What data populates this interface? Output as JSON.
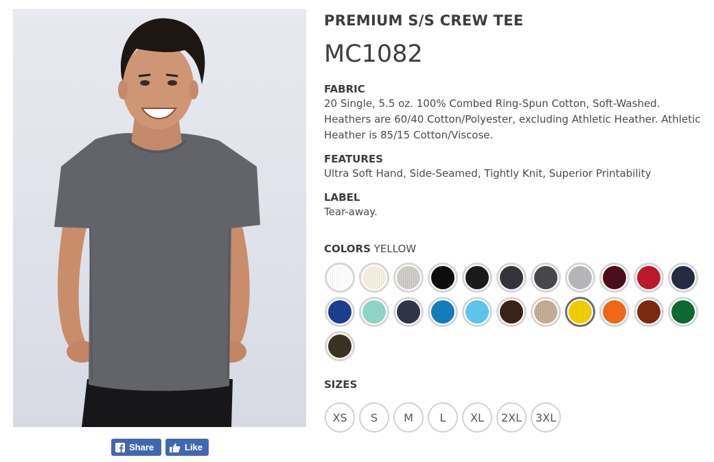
{
  "product": {
    "name": "PREMIUM S/S CREW TEE",
    "style_code": "MC1082"
  },
  "specs": [
    {
      "title": "FABRIC",
      "body": "20 Single, 5.5 oz. 100% Combed Ring-Spun Cotton, Soft-Washed. Heathers are 60/40 Cotton/Polyester, excluding Athletic Heather. Athletic Heather is 85/15 Cotton/Viscose."
    },
    {
      "title": "FEATURES",
      "body": "Ultra Soft Hand, Side-Seamed, Tightly Knit, Superior Printability"
    },
    {
      "title": "LABEL",
      "body": "Tear-away."
    }
  ],
  "colors": {
    "label": "COLORS",
    "selected": "YELLOW",
    "swatches": [
      {
        "hex": "#ffffff"
      },
      {
        "hex": "#f6f1e1"
      },
      {
        "hex": "#cfcdc7"
      },
      {
        "hex": "#0d0d0d"
      },
      {
        "hex": "#1b1b1d"
      },
      {
        "hex": "#34363c"
      },
      {
        "hex": "#48494d"
      },
      {
        "hex": "#b9b9bb"
      },
      {
        "hex": "#4b0f1b"
      },
      {
        "hex": "#c1182b"
      },
      {
        "hex": "#262c42"
      },
      {
        "hex": "#1d3f8f"
      },
      {
        "hex": "#8fd9c9"
      },
      {
        "hex": "#2f3647"
      },
      {
        "hex": "#127fbf"
      },
      {
        "hex": "#5ec9ef"
      },
      {
        "hex": "#3b2417"
      },
      {
        "hex": "#c6ae98"
      },
      {
        "hex": "#f1d100",
        "selected": true
      },
      {
        "hex": "#f36a17"
      },
      {
        "hex": "#7c2b12"
      },
      {
        "hex": "#0d6b34"
      },
      {
        "hex": "#3c3322"
      }
    ]
  },
  "sizes": {
    "label": "SIZES",
    "options": [
      "XS",
      "S",
      "M",
      "L",
      "XL",
      "2XL",
      "3XL"
    ]
  },
  "social": {
    "share_label": "Share",
    "like_label": "Like",
    "brand_color": "#4267b2"
  },
  "image": {
    "shirt_color": "#636469",
    "backdrop_color": "#e2e5ec"
  }
}
